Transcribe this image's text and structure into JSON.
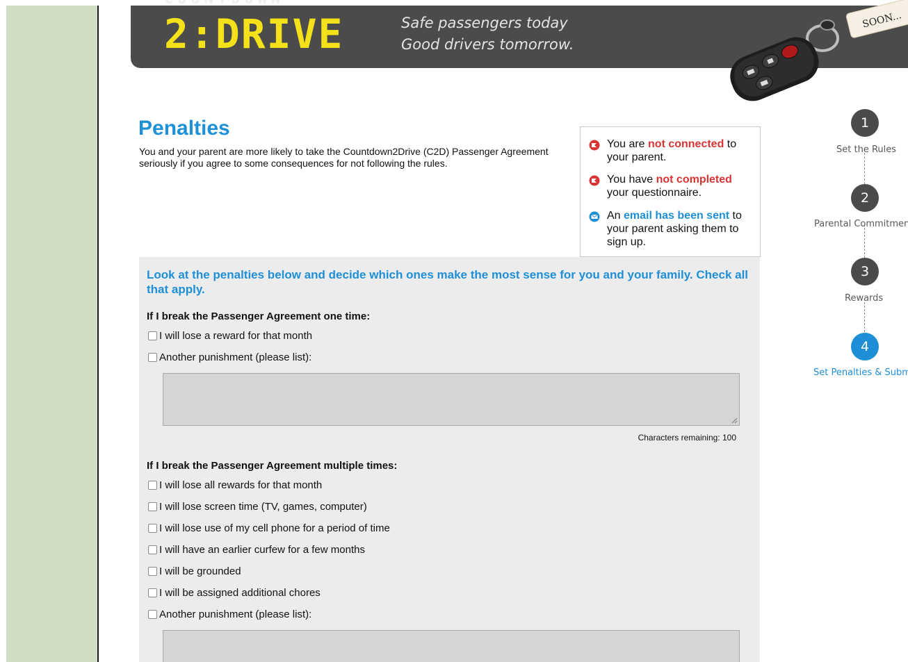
{
  "header": {
    "logo_top": "COUNTDOWN",
    "logo": "2:DRIVE",
    "tagline_line1": "Safe passengers today",
    "tagline_line2": "Good drivers tomorrow.",
    "keychain_tag": "SOON..."
  },
  "page": {
    "title": "Penalties",
    "intro": "You and your parent are more likely to take the Countdown2Drive (C2D) Passenger Agreement seriously if you agree to some consequences for not following the rules."
  },
  "status": {
    "item1": {
      "pre": "You are ",
      "highlight": "not connected",
      "post": " to your parent."
    },
    "item2": {
      "pre": "You have ",
      "highlight": "not completed",
      "post": " your questionnaire."
    },
    "item3": {
      "pre": "An ",
      "highlight": "email has been sent",
      "post": " to your parent asking them to sign up."
    }
  },
  "steps": [
    {
      "number": "1",
      "label": "Set the Rules"
    },
    {
      "number": "2",
      "label": "Parental Commitment"
    },
    {
      "number": "3",
      "label": "Rewards"
    },
    {
      "number": "4",
      "label": "Set Penalties & Submit"
    }
  ],
  "panel": {
    "heading": "Look at the penalties below and decide which ones make the most sense for you and your family. Check all that apply.",
    "one_time": {
      "heading": "If I break the Passenger Agreement one time:",
      "options": [
        "I will lose a reward for that month",
        "Another punishment (please list):"
      ],
      "textarea_value": "",
      "chars_remaining": "Characters remaining: 100"
    },
    "multiple": {
      "heading": "If I break the Passenger Agreement multiple times:",
      "options": [
        "I will lose all rewards for that month",
        "I will lose screen time (TV, games, computer)",
        "I will lose use of my cell phone for a period of time",
        "I will have an earlier curfew for a few months",
        "I will be grounded",
        "I will be assigned additional chores",
        "Another punishment (please list):"
      ],
      "textarea_value": ""
    }
  },
  "colors": {
    "accent_blue": "#1e8fd6",
    "alert_red": "#d83434",
    "logo_yellow": "#f4e11a",
    "header_gray": "#4b4b4b",
    "sidebar_green": "#d1dcc4"
  }
}
